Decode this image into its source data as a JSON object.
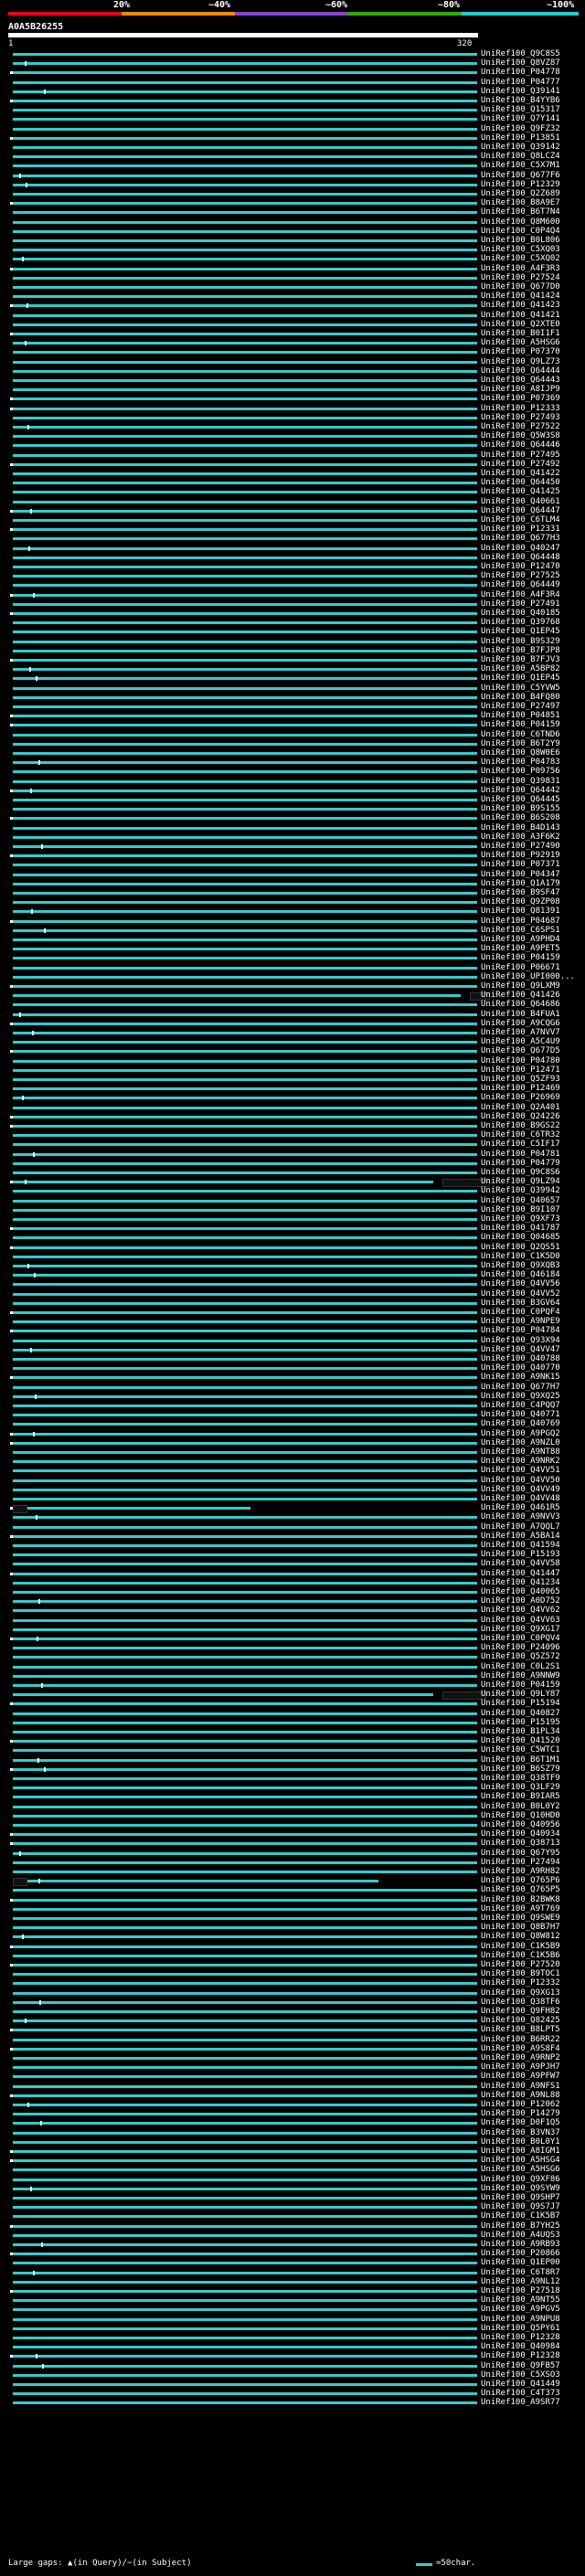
{
  "percent_scale": {
    "labels": [
      "20%",
      "~40%",
      "~60%",
      "~80%",
      "~100%"
    ],
    "colors": [
      "#e8001c",
      "#ee8a00",
      "#8844cc",
      "#33aa00",
      "#22cccc"
    ]
  },
  "query": {
    "id": "A0A5B26255",
    "start": "1",
    "end": "320"
  },
  "hits": [
    "UniRef100_Q9C8S5",
    "UniRef100_Q8VZ87",
    "UniRef100_P04778",
    "UniRef100_P04777",
    "UniRef100_Q39141",
    "UniRef100_B4YYB6",
    "UniRef100_Q15317",
    "UniRef100_Q7Y141",
    "UniRef100_Q9FZ32",
    "UniRef100_P13851",
    "UniRef100_Q39142",
    "UniRef100_Q8LCZ4",
    "UniRef100_C5X7M1",
    "UniRef100_Q677F6",
    "UniRef100_P12329",
    "UniRef100_Q2Z689",
    "UniRef100_B8A9E7",
    "UniRef100_B6T7N4",
    "UniRef100_Q8M600",
    "UniRef100_C0P4Q4",
    "UniRef100_B0L806",
    "UniRef100_C5XQ03",
    "UniRef100_C5XQ02",
    "UniRef100_A4F3R3",
    "UniRef100_P27524",
    "UniRef100_Q677D0",
    "UniRef100_Q41424",
    "UniRef100_Q41423",
    "UniRef100_Q41421",
    "UniRef100_Q2XTE0",
    "UniRef100_B0I1F1",
    "UniRef100_A5HSG6",
    "UniRef100_P07370",
    "UniRef100_Q9LZ73",
    "UniRef100_Q64444",
    "UniRef100_Q64443",
    "UniRef100_A8IJP9",
    "UniRef100_P07369",
    "UniRef100_P12333",
    "UniRef100_P27493",
    "UniRef100_P27522",
    "UniRef100_Q5W3S8",
    "UniRef100_Q64446",
    "UniRef100_P27495",
    "UniRef100_P27492",
    "UniRef100_Q41422",
    "UniRef100_Q64450",
    "UniRef100_Q41425",
    "UniRef100_Q40661",
    "UniRef100_Q64447",
    "UniRef100_C6TLM4",
    "UniRef100_P12331",
    "UniRef100_Q677H3",
    "UniRef100_Q40247",
    "UniRef100_Q64448",
    "UniRef100_P12470",
    "UniRef100_P27525",
    "UniRef100_Q64449",
    "UniRef100_A4F3R4",
    "UniRef100_P27491",
    "UniRef100_Q40185",
    "UniRef100_Q39768",
    "UniRef100_Q1EP45",
    "UniRef100_B9S329",
    "UniRef100_B7FJP8",
    "UniRef100_B7FJV3",
    "UniRef100_A5BP82",
    "UniRef100_Q1EP45",
    "UniRef100_C5YVW5",
    "UniRef100_B4FQ80",
    "UniRef100_P27497",
    "UniRef100_P04851",
    "UniRef100_P04159",
    "UniRef100_C6TND6",
    "UniRef100_B6T2Y9",
    "UniRef100_Q8W0E6",
    "UniRef100_P04783",
    "UniRef100_P09756",
    "UniRef100_Q39831",
    "UniRef100_Q64442",
    "UniRef100_Q64445",
    "UniRef100_B9S155",
    "UniRef100_B6S208",
    "UniRef100_B4D143",
    "UniRef100_A3F6K2",
    "UniRef100_P27490",
    "UniRef100_P92919",
    "UniRef100_P07371",
    "UniRef100_P04347",
    "UniRef100_Q1A179",
    "UniRef100_B9SF47",
    "UniRef100_Q9ZP08",
    "UniRef100_Q81391",
    "UniRef100_P04687",
    "UniRef100_C6SPS1",
    "UniRef100_A9PHD4",
    "UniRef100_A9PET5",
    "UniRef100_P04159",
    "UniRef100_P06671",
    "UniRef100_UPI000...",
    "UniRef100_Q9LXM9",
    "UniRef100_Q41426",
    "UniRef100_Q64686",
    "UniRef100_B4FUA1",
    "UniRef100_A9CQG6",
    "UniRef100_A7NVV7",
    "UniRef100_A5C4U9",
    "UniRef100_Q677D5",
    "UniRef100_P04780",
    "UniRef100_P12471",
    "UniRef100_Q5ZF93",
    "UniRef100_P12469",
    "UniRef100_P26969",
    "UniRef100_Q2A401",
    "UniRef100_Q24226",
    "UniRef100_B9GS22",
    "UniRef100_C6TR32",
    "UniRef100_C5IF17",
    "UniRef100_P04781",
    "UniRef100_P04779",
    "UniRef100_Q9C8S6",
    "UniRef100_Q9LZ94",
    "UniRef100_Q39942",
    "UniRef100_Q40657",
    "UniRef100_B9I107",
    "UniRef100_Q9XF73",
    "UniRef100_Q41787",
    "UniRef100_Q04685",
    "UniRef100_Q2QS51",
    "UniRef100_C1K5D0",
    "UniRef100_Q9XQB3",
    "UniRef100_Q46184",
    "UniRef100_Q4VV56",
    "UniRef100_Q4VV52",
    "UniRef100_B3GV64",
    "UniRef100_C0PQF4",
    "UniRef100_A9NPE9",
    "UniRef100_P04784",
    "UniRef100_Q93X94",
    "UniRef100_Q4VV47",
    "UniRef100_Q40788",
    "UniRef100_Q40770",
    "UniRef100_A9NK15",
    "UniRef100_Q677H7",
    "UniRef100_Q9XQ25",
    "UniRef100_C4PQQ7",
    "UniRef100_Q40771",
    "UniRef100_Q40769",
    "UniRef100_A9PGQ2",
    "UniRef100_A9NZL0",
    "UniRef100_A9NT88",
    "UniRef100_A9NRK2",
    "UniRef100_Q4VV51",
    "UniRef100_Q4VV50",
    "UniRef100_Q4VV49",
    "UniRef100_Q4VV48",
    "UniRef100_Q461R5",
    "UniRef100_A9NVV3",
    "UniRef100_A7QQL7",
    "UniRef100_A5BA14",
    "UniRef100_Q41594",
    "UniRef100_P15193",
    "UniRef100_Q4VV58",
    "UniRef100_Q41447",
    "UniRef100_Q41234",
    "UniRef100_Q40065",
    "UniRef100_A0D752",
    "UniRef100_Q4VV62",
    "UniRef100_Q4VV63",
    "UniRef100_Q9XG17",
    "UniRef100_C0PQV4",
    "UniRef100_P24096",
    "UniRef100_Q5Z572",
    "UniRef100_C0L2S1",
    "UniRef100_A9NNW9",
    "UniRef100_P04159",
    "UniRef100_Q9LY87",
    "UniRef100_P15194",
    "UniRef100_Q40827",
    "UniRef100_P15195",
    "UniRef100_B1PL34",
    "UniRef100_Q41520",
    "UniRef100_C5WTC1",
    "UniRef100_B6T1M1",
    "UniRef100_B6SZ79",
    "UniRef100_Q38TF9",
    "UniRef100_Q3LF29",
    "UniRef100_B9IAR5",
    "UniRef100_B0L0Y2",
    "UniRef100_Q10HD0",
    "UniRef100_Q40956",
    "UniRef100_Q40934",
    "UniRef100_Q38713",
    "UniRef100_Q67Y95",
    "UniRef100_P27494",
    "UniRef100_A9RH82",
    "UniRef100_Q765P6",
    "UniRef100_Q765P5",
    "UniRef100_B2BWK8",
    "UniRef100_A9T769",
    "UniRef100_Q9SWE9",
    "UniRef100_Q8B7H7",
    "UniRef100_Q8W812",
    "UniRef100_C1K5B9",
    "UniRef100_C1K5B6",
    "UniRef100_P27520",
    "UniRef100_B9TOC1",
    "UniRef100_P12332",
    "UniRef100_Q9XG13",
    "UniRef100_Q38TF6",
    "UniRef100_Q9FH82",
    "UniRef100_Q82425",
    "UniRef100_B8LPT5",
    "UniRef100_B6RR22",
    "UniRef100_A9S8F4",
    "UniRef100_A9RNP2",
    "UniRef100_A9PJH7",
    "UniRef100_A9PFW7",
    "UniRef100_A9NFS1",
    "UniRef100_A9NL88",
    "UniRef100_P12062",
    "UniRef100_P14279",
    "UniRef100_D0F1Q5",
    "UniRef100_B3VN37",
    "UniRef100_B0L0Y1",
    "UniRef100_A8IGM1",
    "UniRef100_A5HSG4",
    "UniRef100_A5HSG6",
    "UniRef100_Q9XF86",
    "UniRef100_Q9SYW9",
    "UniRef100_Q9SHP7",
    "UniRef100_Q9S7J7",
    "UniRef100_C1K5B7",
    "UniRef100_B7YH25",
    "UniRef100_A4UQS3",
    "UniRef100_A9RB93",
    "UniRef100_P20866",
    "UniRef100_Q1EP00",
    "UniRef100_C6T8R7",
    "UniRef100_A9NL12",
    "UniRef100_P27518",
    "UniRef100_A9NT55",
    "UniRef100_A9PGV5",
    "UniRef100_A9NPU8",
    "UniRef100_Q5PY61",
    "UniRef100_P12328",
    "UniRef100_Q40984",
    "UniRef100_P12328",
    "UniRef100_Q9FB57",
    "UniRef100_C5XSO3",
    "UniRef100_Q41449",
    "UniRef100_C4T373",
    "UniRef100_A9SR77"
  ],
  "legend": {
    "large_gaps": "Large gaps: ▲(in Query)/−(in Subject)",
    "scale_label": "=50char."
  }
}
